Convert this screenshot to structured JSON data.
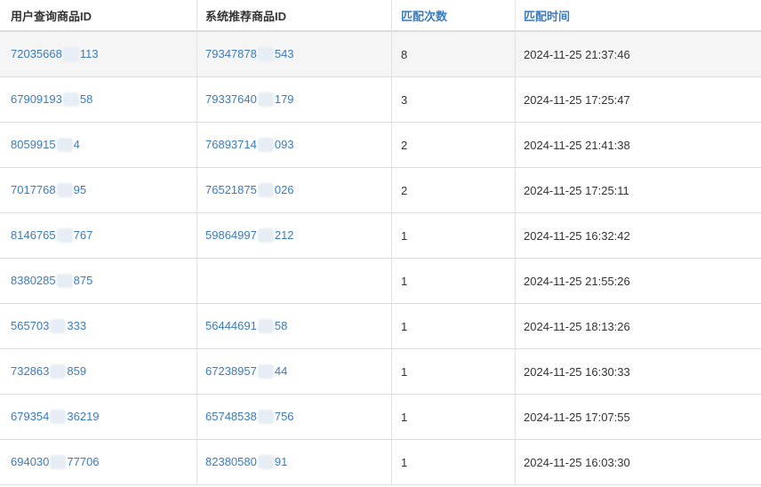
{
  "columns": {
    "user_query_id": "用户查询商品ID",
    "system_rec_id": "系统推荐商品ID",
    "match_count": "匹配次数",
    "match_time": "匹配时间"
  },
  "rows": [
    {
      "q_pre": "72035668",
      "q_post": "113",
      "r_pre": "79347878",
      "r_post": "543",
      "count": "8",
      "time": "2024-11-25 21:37:46",
      "highlight": true
    },
    {
      "q_pre": "67909193",
      "q_post": "58",
      "r_pre": "79337640",
      "r_post": "179",
      "count": "3",
      "time": "2024-11-25 17:25:47"
    },
    {
      "q_pre": "8059915",
      "q_post": "4",
      "r_pre": "76893714",
      "r_post": "093",
      "count": "2",
      "time": "2024-11-25 21:41:38"
    },
    {
      "q_pre": "7017768",
      "q_post": "95",
      "r_pre": "76521875",
      "r_post": "026",
      "count": "2",
      "time": "2024-11-25 17:25:11"
    },
    {
      "q_pre": "8146765",
      "q_post": "767",
      "r_pre": "59864997",
      "r_post": "212",
      "count": "1",
      "time": "2024-11-25 16:32:42"
    },
    {
      "q_pre": "8380285",
      "q_post": "875",
      "r_pre": "",
      "r_post": "",
      "count": "1",
      "time": "2024-11-25 21:55:26"
    },
    {
      "q_pre": "565703",
      "q_post": "333",
      "r_pre": "56444691",
      "r_post": "58",
      "count": "1",
      "time": "2024-11-25 18:13:26"
    },
    {
      "q_pre": "732863",
      "q_post": "859",
      "r_pre": "67238957",
      "r_post": "44",
      "count": "1",
      "time": "2024-11-25 16:30:33"
    },
    {
      "q_pre": "679354",
      "q_post": "36219",
      "r_pre": "65748538",
      "r_post": "756",
      "count": "1",
      "time": "2024-11-25 17:07:55"
    },
    {
      "q_pre": "694030",
      "q_post": "77706",
      "r_pre": "82380580",
      "r_post": "91",
      "count": "1",
      "time": "2024-11-25 16:03:30"
    }
  ]
}
